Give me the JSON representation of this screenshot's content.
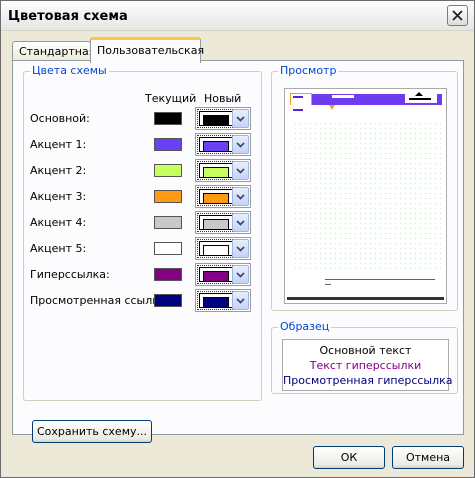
{
  "window": {
    "title": "Цветовая схема",
    "close_icon": "close-icon"
  },
  "tabs": [
    {
      "label": "Стандартная",
      "active": false
    },
    {
      "label": "Пользовательская",
      "active": true
    }
  ],
  "colors_group": {
    "title": "Цвета схемы",
    "col_current": "Текущий",
    "col_new": "Новый",
    "rows": [
      {
        "label": "Основной:",
        "current": "#000000",
        "new": "#000000"
      },
      {
        "label": "Акцент 1:",
        "current": "#6a40f2",
        "new": "#6a40f2"
      },
      {
        "label": "Акцент 2:",
        "current": "#c8ff60",
        "new": "#c8ff60"
      },
      {
        "label": "Акцент 3:",
        "current": "#ff9a14",
        "new": "#ff9a14"
      },
      {
        "label": "Акцент 4:",
        "current": "#c8c8c8",
        "new": "#c8c8c8"
      },
      {
        "label": "Акцент 5:",
        "current": "#ffffff",
        "new": "#ffffff"
      },
      {
        "label": "Гиперссылка:",
        "current": "#840084",
        "new": "#840084"
      },
      {
        "label": "Просмотренная ссылка:",
        "current": "#000080",
        "new": "#000080"
      }
    ],
    "save_label": "Сохранить схему..."
  },
  "preview_group": {
    "title": "Просмотр"
  },
  "sample_group": {
    "title": "Образец",
    "main_text": "Основной текст",
    "hyperlink_text": "Текст гиперссылки",
    "visited_text": "Просмотренная гиперссылка",
    "main_color": "#000000",
    "hyperlink_color": "#840084",
    "visited_color": "#000080"
  },
  "footer": {
    "ok_label": "ОК",
    "cancel_label": "Отмена"
  }
}
